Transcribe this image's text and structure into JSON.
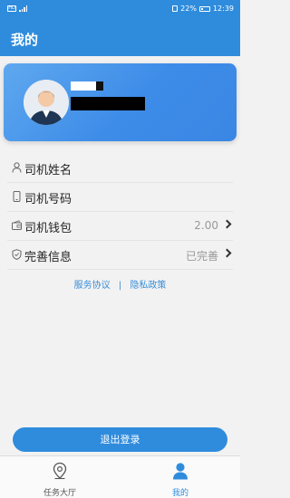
{
  "status_bar": {
    "signal_label": "HD",
    "battery": "22%",
    "time": "12:39"
  },
  "header": {
    "title": "我的"
  },
  "list": {
    "items": [
      {
        "label": "司机姓名",
        "value": "",
        "icon": "person-icon",
        "chevron": false
      },
      {
        "label": "司机号码",
        "value": "",
        "icon": "phone-icon",
        "chevron": false
      },
      {
        "label": "司机钱包",
        "value": "2.00",
        "icon": "wallet-icon",
        "chevron": true
      },
      {
        "label": "完善信息",
        "value": "已完善",
        "icon": "shield-icon",
        "chevron": true
      }
    ]
  },
  "links": {
    "service": "服务协议",
    "separator": "|",
    "privacy": "隐私政策"
  },
  "logout_label": "退出登录",
  "tabbar": {
    "tabs": [
      {
        "label": "任务大厅",
        "icon": "location-pin-icon",
        "active": false
      },
      {
        "label": "我的",
        "icon": "user-icon",
        "active": true
      }
    ]
  },
  "colors": {
    "primary": "#2f8cdd",
    "card_gradient_start": "#5fa8ef",
    "card_gradient_end": "#3a86e4",
    "link": "#3a8ed8"
  }
}
